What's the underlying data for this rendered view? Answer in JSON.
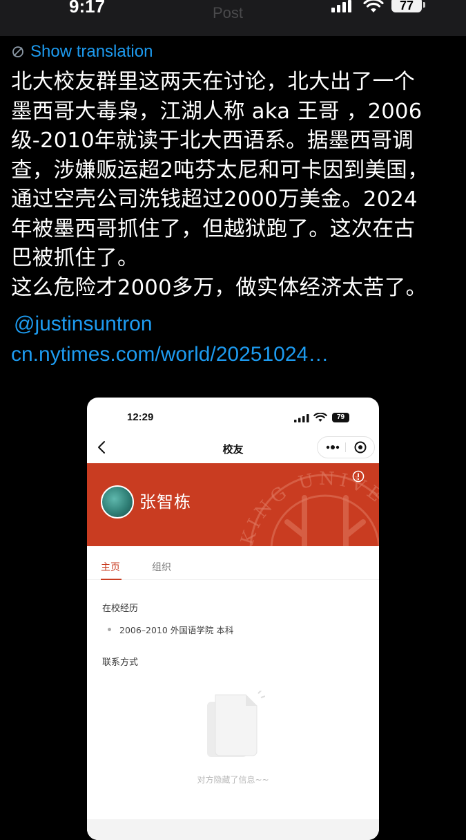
{
  "status_bar": {
    "time": "9:17",
    "faded_header": "Post",
    "battery": "77"
  },
  "tweet": {
    "show_translation": "Show translation",
    "lines": [
      "北大校友群里这两天在讨论，北大出了一个",
      "墨西哥大毒枭，江湖人称 aka 王哥 ，2006",
      "级-2010年就读于北大西语系。据墨西哥调",
      "查，涉嫌贩运超2吨芬太尼和可卡因到美国，",
      "通过空壳公司洗钱超过2000万美金。2024",
      "年被墨西哥抓住了，但越狱跑了。这次在古",
      "巴被抓住了。",
      "这么危险才2000多万，做实体经济太苦了。"
    ],
    "mention": "@justinsuntron",
    "url": "cn.nytimes.com/world/20251024…"
  },
  "embedded": {
    "status": {
      "time": "12:29",
      "battery": "79"
    },
    "nav_title": "校友",
    "profile_name": "张智栋",
    "emblem_text": "KING UNIVERS",
    "tabs": [
      "主页",
      "组织"
    ],
    "education_title": "在校经历",
    "education_item": "2006–2010 外国语学院 本科",
    "contact_title": "联系方式",
    "hidden_message": "对方隐藏了信息~~"
  },
  "colors": {
    "link": "#1d9bf0",
    "banner": "#c93c21",
    "background": "#000000"
  }
}
